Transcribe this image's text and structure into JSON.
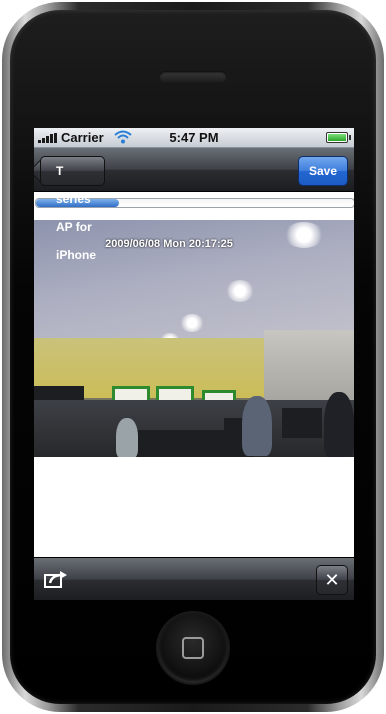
{
  "status_bar": {
    "carrier": "Carrier",
    "time": "5:47 PM",
    "battery_level": 1.0,
    "signal_bars": 5,
    "wifi_icon": "wifi-icon"
  },
  "nav_bar": {
    "back_label": "T series AP for iPhone",
    "save_label": "Save"
  },
  "progress": {
    "value": 0.26,
    "color": "#2f6fc7"
  },
  "video": {
    "timestamp": "2009/06/08 Mon 20:17:25"
  },
  "toolbar": {
    "share_icon": "share-icon",
    "close_icon": "close-icon",
    "close_glyph": "✕"
  },
  "colors": {
    "save_button": "#2467d1",
    "bar_dark": "#2b2d31"
  }
}
